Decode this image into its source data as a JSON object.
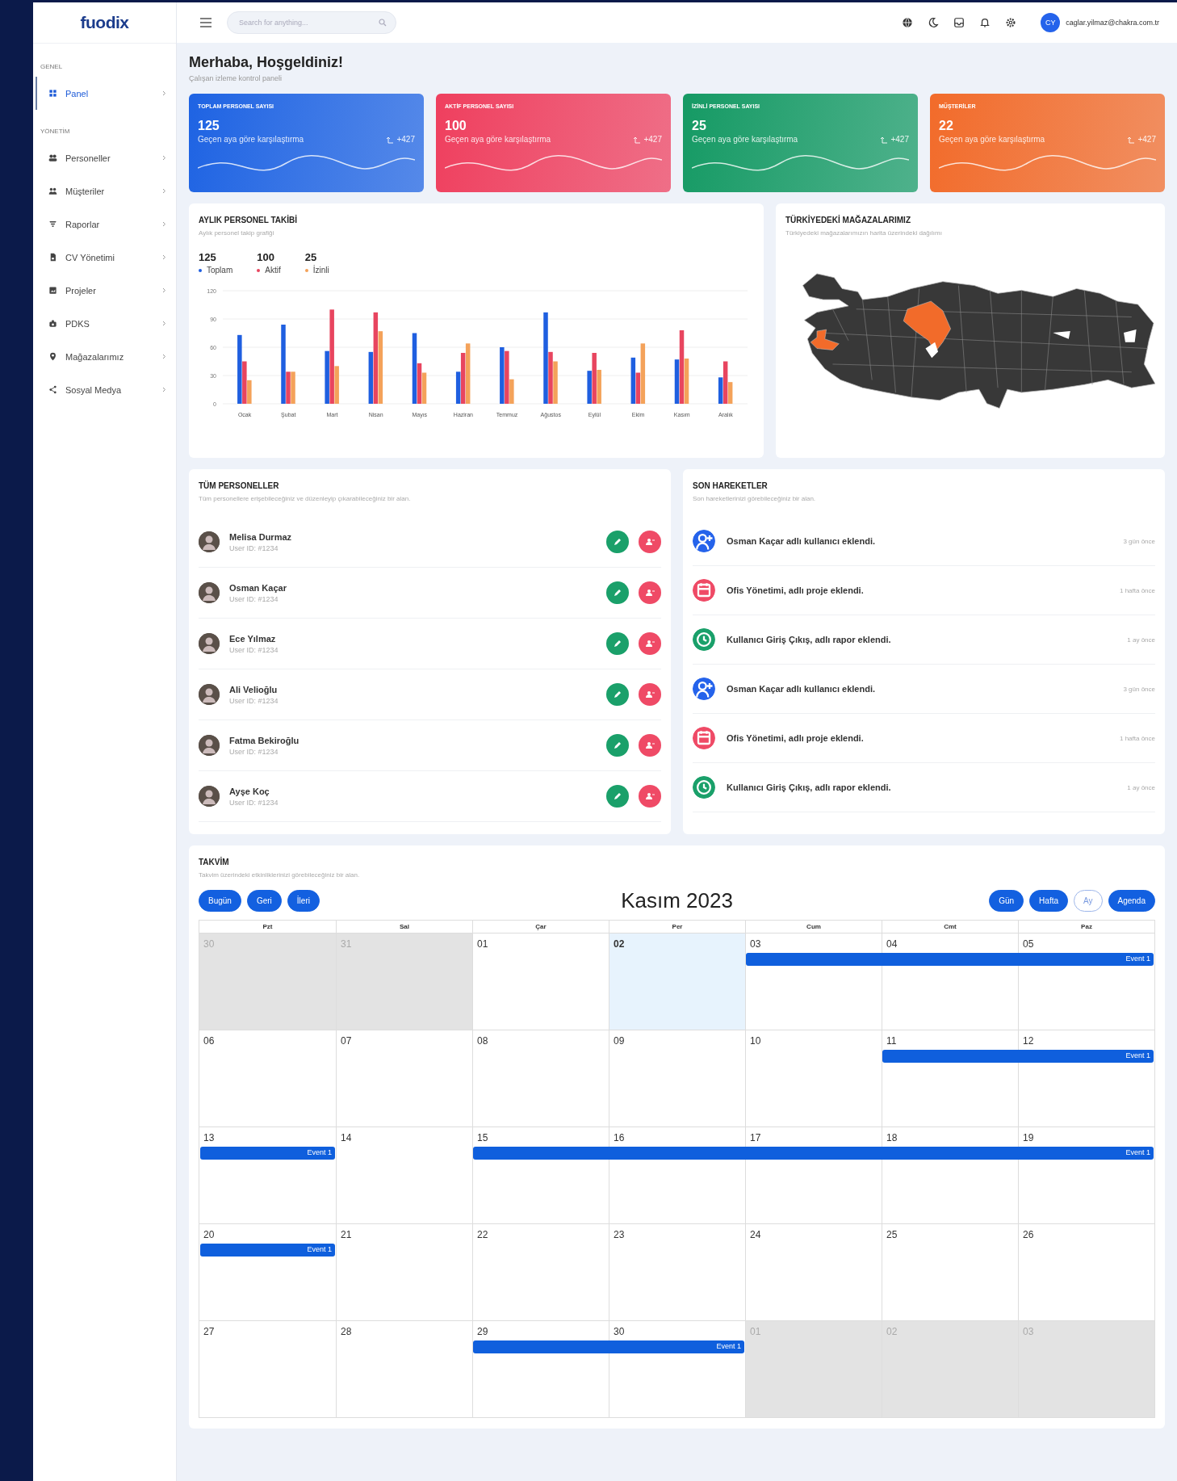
{
  "brand": {
    "logo": "fuodix"
  },
  "topbar": {
    "search": {
      "placeholder": "Search for anything..."
    },
    "user": {
      "initials": "CY",
      "email": "caglar.yilmaz@chakra.com.tr"
    }
  },
  "sidebar": {
    "sections": [
      {
        "title": "GENEL",
        "items": [
          {
            "label": "Panel",
            "selected": true
          }
        ]
      },
      {
        "title": "YÖNETİM",
        "items": [
          {
            "label": "Personeller",
            "selected": false
          },
          {
            "label": "Müşteriler",
            "selected": false
          },
          {
            "label": "Raporlar",
            "selected": false
          },
          {
            "label": "CV Yönetimi",
            "selected": false
          },
          {
            "label": "Projeler",
            "selected": false
          },
          {
            "label": "PDKS",
            "selected": false
          },
          {
            "label": "Mağazalarımız",
            "selected": false
          },
          {
            "label": "Sosyal Medya",
            "selected": false
          }
        ]
      }
    ]
  },
  "header": {
    "title": "Merhaba, Hoşgeldiniz!",
    "subtitle": "Çalışan izleme kontrol paneli"
  },
  "stat_cards": [
    {
      "title": "TOPLAM PERSONEL SAYISI",
      "value": "125",
      "subtitle": "Geçen aya göre karşılaştırma",
      "change": "+427",
      "color": "#1e63e3"
    },
    {
      "title": "AKTİF PERSONEL SAYISI",
      "value": "100",
      "subtitle": "Geçen aya göre karşılaştırma",
      "change": "+427",
      "color": "#ef3f5e"
    },
    {
      "title": "İZİNLİ PERSONEL SAYISI",
      "value": "25",
      "subtitle": "Geçen aya göre karşılaştırma",
      "change": "+427",
      "color": "#159a64"
    },
    {
      "title": "MÜŞTERİLER",
      "value": "22",
      "subtitle": "Geçen aya göre karşılaştırma",
      "change": "+427",
      "color": "#f26b2a"
    }
  ],
  "monthly_chart": {
    "title": "AYLIK PERSONEL TAKİBİ",
    "subtitle": "Aylık personel takip grafiği",
    "summary": [
      "125",
      "100",
      "25"
    ],
    "chart_data": {
      "type": "bar",
      "categories": [
        "Ocak",
        "Şubat",
        "Mart",
        "Nisan",
        "Mayıs",
        "Haziran",
        "Temmuz",
        "Ağustos",
        "Eylül",
        "Ekim",
        "Kasım",
        "Aralık"
      ],
      "series": [
        {
          "name": "Toplam",
          "color": "#1f5fe0",
          "values": [
            73,
            84,
            56,
            55,
            75,
            34,
            60,
            97,
            35,
            49,
            47,
            28
          ]
        },
        {
          "name": "Aktif",
          "color": "#e8455f",
          "values": [
            45,
            34,
            100,
            97,
            43,
            54,
            56,
            55,
            54,
            33,
            78,
            45
          ]
        },
        {
          "name": "İzinli",
          "color": "#f4a25a",
          "values": [
            25,
            34,
            40,
            77,
            33,
            64,
            26,
            45,
            36,
            64,
            48,
            23
          ]
        }
      ],
      "ylim": [
        0,
        120
      ],
      "yticks": [
        0,
        30,
        60,
        90,
        120
      ],
      "grid": true
    }
  },
  "stores_map": {
    "title": "TÜRKİYEDEKİ MAĞAZALARIMIZ",
    "subtitle": "Türkiyedeki mağazalarımızın harita üzerindeki dağılımı"
  },
  "personnel": {
    "title": "TÜM PERSONELLER",
    "subtitle": "Tüm personellere erişebileceğiniz ve düzenleyip çıkarabileceğiniz bir alan.",
    "rows": [
      {
        "name": "Melisa Durmaz",
        "user_id": "User ID: #1234"
      },
      {
        "name": "Osman Kaçar",
        "user_id": "User ID: #1234"
      },
      {
        "name": "Ece Yılmaz",
        "user_id": "User ID: #1234"
      },
      {
        "name": "Ali Velioğlu",
        "user_id": "User ID: #1234"
      },
      {
        "name": "Fatma Bekiroğlu",
        "user_id": "User ID: #1234"
      },
      {
        "name": "Ayşe Koç",
        "user_id": "User ID: #1234"
      }
    ]
  },
  "activities": {
    "title": "SON HAREKETLER",
    "subtitle": "Son hareketlerinizi görebileceğiniz bir alan.",
    "items": [
      {
        "kind": "user",
        "text": "Osman Kaçar adlı kullanıcı eklendi.",
        "time": "3 gün önce"
      },
      {
        "kind": "project",
        "text": "Ofis Yönetimi, adlı proje eklendi.",
        "time": "1 hafta önce"
      },
      {
        "kind": "report",
        "text": "Kullanıcı Giriş Çıkış, adlı rapor eklendi.",
        "time": "1 ay önce"
      },
      {
        "kind": "user",
        "text": "Osman Kaçar adlı kullanıcı eklendi.",
        "time": "3 gün önce"
      },
      {
        "kind": "project",
        "text": "Ofis Yönetimi, adlı proje eklendi.",
        "time": "1 hafta önce"
      },
      {
        "kind": "report",
        "text": "Kullanıcı Giriş Çıkış, adlı rapor eklendi.",
        "time": "1 ay önce"
      }
    ]
  },
  "calendar": {
    "title": "TAKVİM",
    "subtitle": "Takvim üzerindeki etkinliklerinizi görebileceğiniz bir alan.",
    "nav_buttons": [
      "Bugün",
      "Geri",
      "İleri"
    ],
    "month": "Kasım 2023",
    "views": [
      {
        "label": "Gün",
        "selected": false
      },
      {
        "label": "Hafta",
        "selected": false
      },
      {
        "label": "Ay",
        "selected": true
      },
      {
        "label": "Agenda",
        "selected": false
      }
    ],
    "weekdays": [
      "Pzt",
      "Sal",
      "Çar",
      "Per",
      "Cum",
      "Cmt",
      "Paz"
    ],
    "weeks": [
      {
        "days": [
          {
            "label": "30",
            "outside": true,
            "today": false,
            "event": false
          },
          {
            "label": "31",
            "outside": true,
            "today": false,
            "event": false
          },
          {
            "label": "01",
            "outside": false,
            "today": false,
            "event": false
          },
          {
            "label": "02",
            "outside": false,
            "today": true,
            "event": false
          },
          {
            "label": "03",
            "outside": false,
            "today": false,
            "event": true
          },
          {
            "label": "04",
            "outside": false,
            "today": false,
            "event": true
          },
          {
            "label": "05",
            "outside": false,
            "today": false,
            "event": true
          }
        ],
        "events": [
          "Event 1"
        ]
      },
      {
        "days": [
          {
            "label": "06",
            "outside": false,
            "today": false,
            "event": false
          },
          {
            "label": "07",
            "outside": false,
            "today": false,
            "event": false
          },
          {
            "label": "08",
            "outside": false,
            "today": false,
            "event": false
          },
          {
            "label": "09",
            "outside": false,
            "today": false,
            "event": false
          },
          {
            "label": "10",
            "outside": false,
            "today": false,
            "event": false
          },
          {
            "label": "11",
            "outside": false,
            "today": false,
            "event": true
          },
          {
            "label": "12",
            "outside": false,
            "today": false,
            "event": true
          }
        ],
        "events": [
          "Event 1"
        ]
      },
      {
        "days": [
          {
            "label": "13",
            "outside": false,
            "today": false,
            "event": true
          },
          {
            "label": "14",
            "outside": false,
            "today": false,
            "event": false
          },
          {
            "label": "15",
            "outside": false,
            "today": false,
            "event": true
          },
          {
            "label": "16",
            "outside": false,
            "today": false,
            "event": true
          },
          {
            "label": "17",
            "outside": false,
            "today": false,
            "event": true
          },
          {
            "label": "18",
            "outside": false,
            "today": false,
            "event": true
          },
          {
            "label": "19",
            "outside": false,
            "today": false,
            "event": true
          }
        ],
        "events": [
          "Event 1",
          "Event 1"
        ]
      },
      {
        "days": [
          {
            "label": "20",
            "outside": false,
            "today": false,
            "event": true
          },
          {
            "label": "21",
            "outside": false,
            "today": false,
            "event": false
          },
          {
            "label": "22",
            "outside": false,
            "today": false,
            "event": false
          },
          {
            "label": "23",
            "outside": false,
            "today": false,
            "event": false
          },
          {
            "label": "24",
            "outside": false,
            "today": false,
            "event": false
          },
          {
            "label": "25",
            "outside": false,
            "today": false,
            "event": false
          },
          {
            "label": "26",
            "outside": false,
            "today": false,
            "event": false
          }
        ],
        "events": [
          "Event 1"
        ]
      },
      {
        "days": [
          {
            "label": "27",
            "outside": false,
            "today": false,
            "event": false
          },
          {
            "label": "28",
            "outside": false,
            "today": false,
            "event": false
          },
          {
            "label": "29",
            "outside": false,
            "today": false,
            "event": true
          },
          {
            "label": "30",
            "outside": false,
            "today": false,
            "event": true
          },
          {
            "label": "01",
            "outside": true,
            "today": false,
            "event": false
          },
          {
            "label": "02",
            "outside": true,
            "today": false,
            "event": false
          },
          {
            "label": "03",
            "outside": true,
            "today": false,
            "event": false
          }
        ],
        "events": [
          "Event 1"
        ]
      }
    ]
  }
}
